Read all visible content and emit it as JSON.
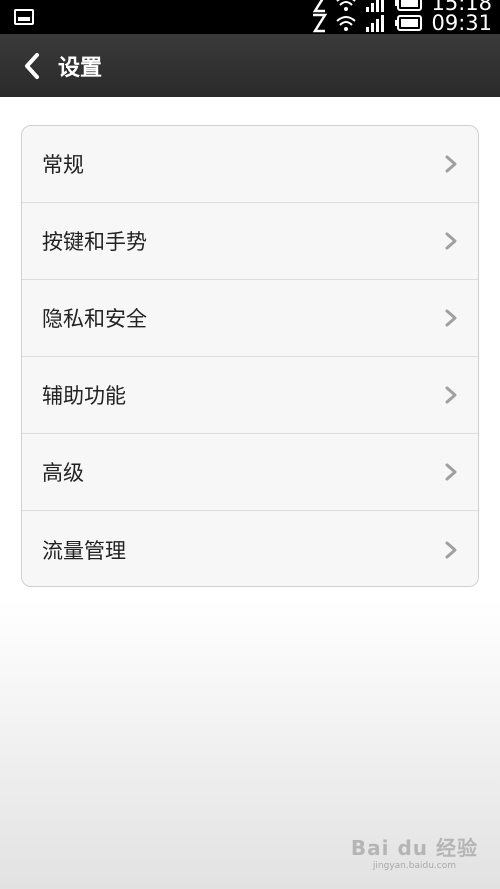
{
  "status_bar": {
    "time_top": "15:18",
    "time_bottom": "09:31"
  },
  "header": {
    "title": "设置"
  },
  "settings": {
    "items": [
      {
        "label": "常规"
      },
      {
        "label": "按键和手势"
      },
      {
        "label": "隐私和安全"
      },
      {
        "label": "辅助功能"
      },
      {
        "label": "高级"
      },
      {
        "label": "流量管理"
      }
    ]
  },
  "watermark": {
    "main": "Bai du 经验",
    "sub": "jingyan.baidu.com"
  },
  "icons": {
    "back": "chevron-left-icon",
    "row_arrow": "chevron-right-icon",
    "gallery": "image-icon",
    "wifi": "wifi-icon",
    "signal": "signal-icon",
    "battery": "battery-icon",
    "no_sim": "no-sim-icon"
  },
  "colors": {
    "status_bar": "#000000",
    "header": "#2f2f2f",
    "card_bg": "#f7f7f7",
    "card_border": "#d0d0d0",
    "text": "#222222",
    "chevron": "#a0a0a0"
  }
}
